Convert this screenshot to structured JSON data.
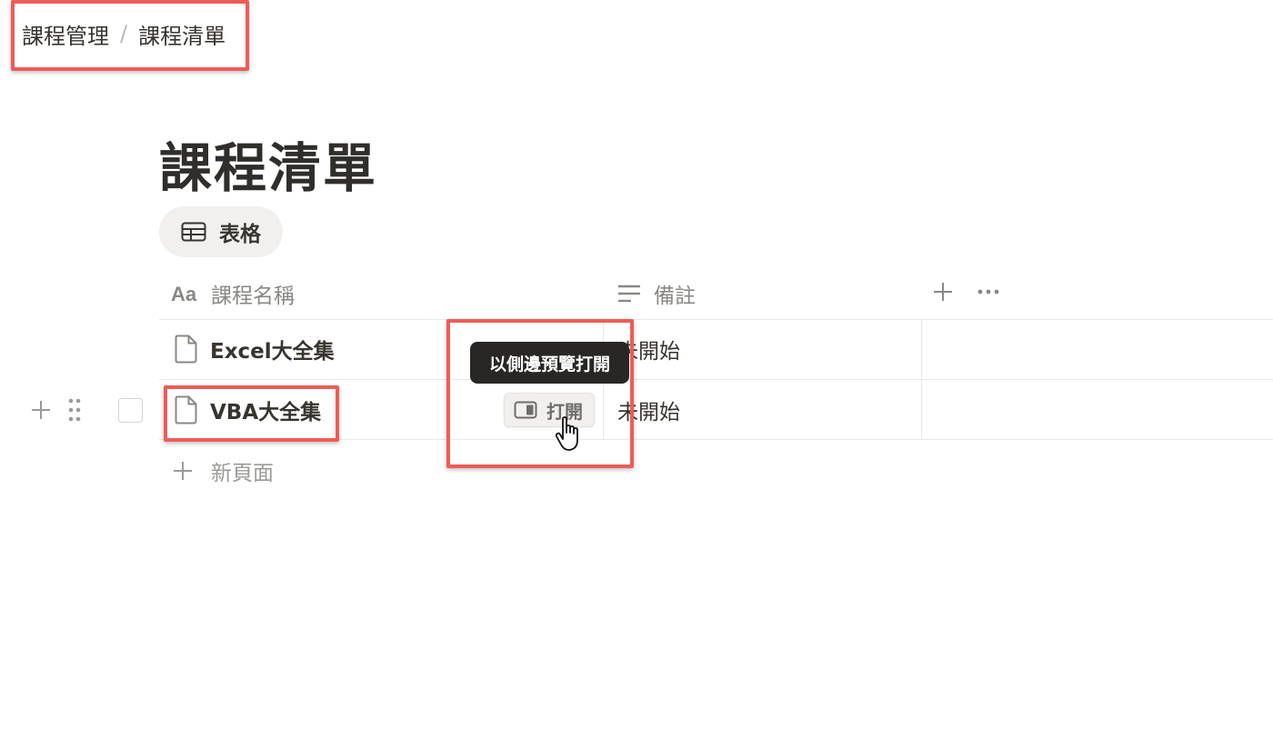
{
  "breadcrumb": {
    "items": [
      "課程管理",
      "課程清單"
    ],
    "separator": "/"
  },
  "page": {
    "title": "課程清單"
  },
  "view_tab": {
    "label": "表格",
    "icon": "table-icon"
  },
  "table": {
    "columns": [
      {
        "label": "課程名稱",
        "icon": "text-type-icon"
      },
      {
        "label": "備註",
        "icon": "text-lines-icon"
      }
    ],
    "rows": [
      {
        "name": "Excel大全集",
        "note": "未開始",
        "icon": "page-icon"
      },
      {
        "name": "VBA大全集",
        "note": "未開始",
        "icon": "page-icon"
      }
    ],
    "add_column_icon": "plus-icon",
    "more_icon": "more-horizontal-icon",
    "new_page_label": "新頁面"
  },
  "row_actions": {
    "open_label": "打開",
    "open_icon": "side-peek-icon",
    "tooltip": "以側邊預覽打開"
  },
  "colors": {
    "highlight": "#ef5c56",
    "tooltip_bg": "#282725",
    "text": "#37352f",
    "muted": "#8a8884"
  }
}
